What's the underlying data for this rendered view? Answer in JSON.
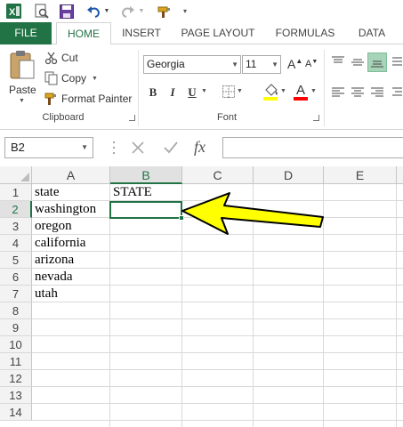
{
  "qat": {
    "icons": [
      "excel-logo-icon",
      "print-preview-icon",
      "save-icon",
      "undo-icon",
      "undo-dropdown-icon",
      "redo-icon",
      "redo-dropdown-icon",
      "format-painter-qat-icon",
      "customize-qat-icon"
    ]
  },
  "tabs": [
    {
      "label": "FILE"
    },
    {
      "label": "HOME"
    },
    {
      "label": "INSERT"
    },
    {
      "label": "PAGE LAYOUT"
    },
    {
      "label": "FORMULAS"
    },
    {
      "label": "DATA"
    }
  ],
  "clipboard": {
    "paste_label": "Paste",
    "cut_label": "Cut",
    "copy_label": "Copy",
    "format_painter_label": "Format Painter",
    "group_label": "Clipboard"
  },
  "font": {
    "name": "Georgia",
    "size": "11",
    "bold": "B",
    "italic": "I",
    "underline": "U",
    "grow": "A",
    "shrink": "A",
    "color_letter": "A",
    "group_label": "Font",
    "fill_color": "#ffff00",
    "font_color": "#ff0000"
  },
  "formula_bar": {
    "name_box": "B2",
    "fx_label": "fx",
    "value": ""
  },
  "columns": [
    "A",
    "B",
    "C",
    "D",
    "E"
  ],
  "rows": [
    "1",
    "2",
    "3",
    "4",
    "5",
    "6",
    "7",
    "8",
    "9",
    "10",
    "11",
    "12",
    "13",
    "14"
  ],
  "cells": {
    "A1": "state",
    "B1": "STATE",
    "A2": "washington",
    "A3": "oregon",
    "A4": "california",
    "A5": "arizona",
    "A6": "nevada",
    "A7": "utah"
  },
  "selection": {
    "cell": "B2"
  },
  "colors": {
    "accent": "#217346",
    "arrow_fill": "#ffff00",
    "arrow_stroke": "#000000"
  }
}
